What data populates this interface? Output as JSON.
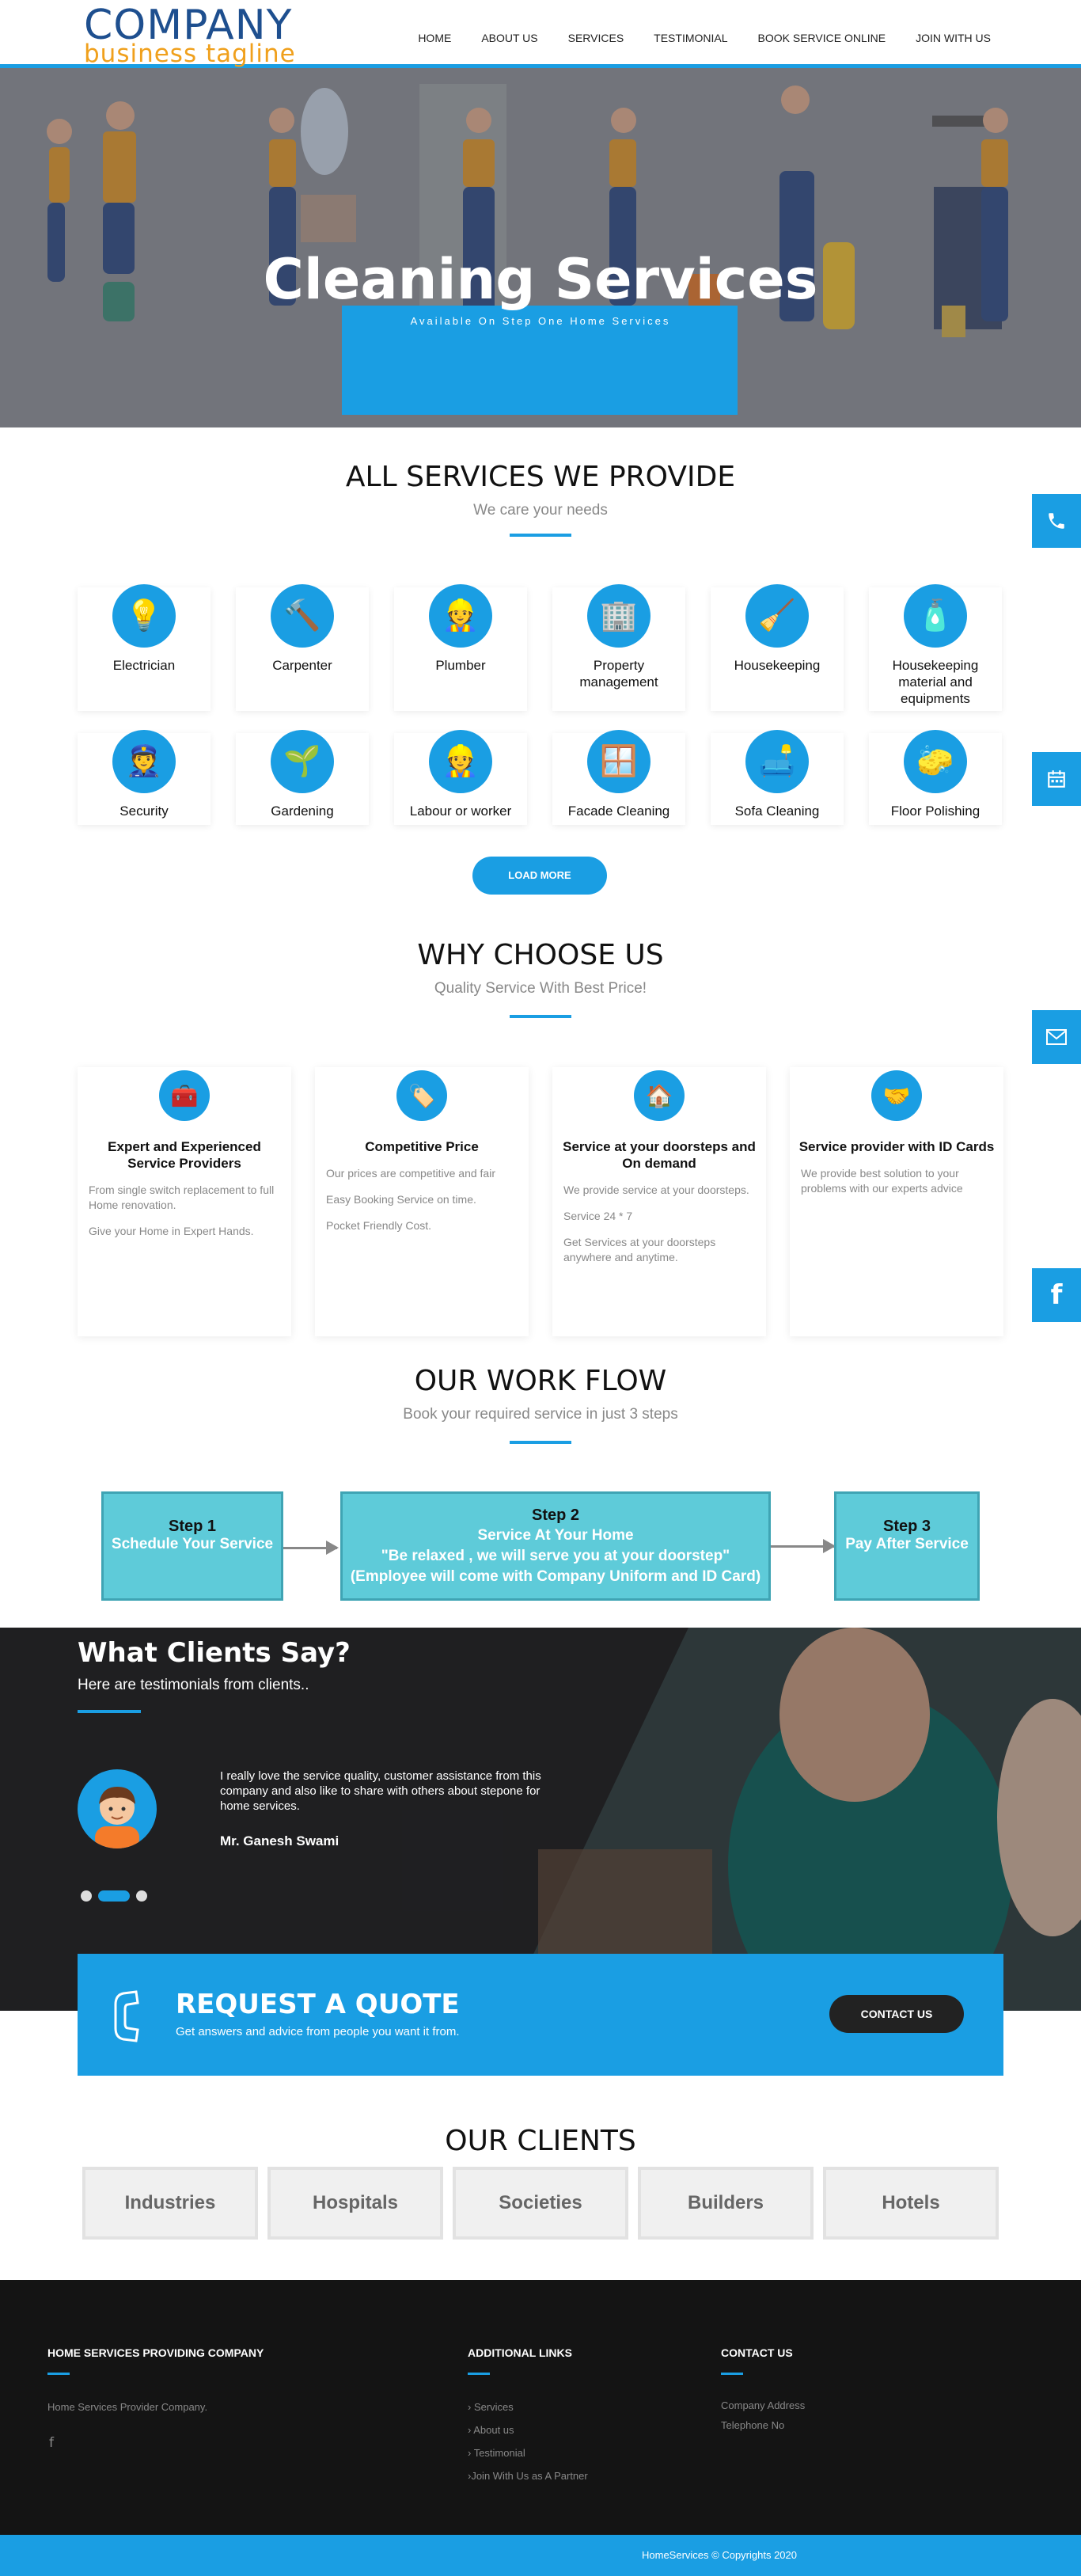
{
  "header": {
    "logo_main": "COMPANY",
    "logo_tagline": "business tagline",
    "nav": [
      "HOME",
      "ABOUT US",
      "SERVICES",
      "TESTIMONIAL",
      "BOOK SERVICE ONLINE",
      "JOIN WITH US"
    ]
  },
  "hero": {
    "title": "Cleaning Services",
    "subtitle": "Available On Step One Home Services"
  },
  "services": {
    "title": "ALL SERVICES WE PROVIDE",
    "subtitle": "We care your needs",
    "items": [
      {
        "label": "Electrician",
        "icon": "bulb-icon"
      },
      {
        "label": "Carpenter",
        "icon": "hammer-icon"
      },
      {
        "label": "Plumber",
        "icon": "plumber-icon"
      },
      {
        "label": "Property management",
        "icon": "property-icon"
      },
      {
        "label": "Housekeeping",
        "icon": "broom-icon"
      },
      {
        "label": "Housekeeping material and equipments",
        "icon": "supplies-icon"
      },
      {
        "label": "Security",
        "icon": "guard-icon"
      },
      {
        "label": "Gardening",
        "icon": "plant-icon"
      },
      {
        "label": "Labour or worker",
        "icon": "worker-icon"
      },
      {
        "label": "Facade Cleaning",
        "icon": "window-cleaning-icon"
      },
      {
        "label": "Sofa Cleaning",
        "icon": "sofa-icon"
      },
      {
        "label": "Floor Polishing",
        "icon": "mop-icon"
      }
    ],
    "load_more": "LOAD MORE"
  },
  "why": {
    "title": "WHY CHOOSE US",
    "subtitle": "Quality Service With Best Price!",
    "cards": [
      {
        "title": "Expert and Experienced Service Providers",
        "icon": "expert-icon",
        "lines": [
          "From single switch replacement to full Home renovation.",
          "Give your Home in Expert Hands."
        ]
      },
      {
        "title": "Competitive Price",
        "icon": "price-tag-icon",
        "lines": [
          "Our prices are competitive and fair",
          "Easy Booking Service on time.",
          "Pocket Friendly Cost."
        ]
      },
      {
        "title": "Service at your doorsteps and On demand",
        "icon": "home-icon",
        "lines": [
          "We provide service at your doorsteps.",
          "Service 24 * 7",
          "Get Services at your doorsteps anywhere and anytime."
        ]
      },
      {
        "title": "Service provider with ID Cards",
        "icon": "id-card-icon",
        "lines": [
          "We provide best solution to your problems with our experts advice"
        ]
      }
    ]
  },
  "workflow": {
    "title": "OUR WORK FLOW",
    "subtitle": "Book your required service in just 3 steps",
    "steps": [
      {
        "num": "Step 1",
        "text": "Schedule Your Service"
      },
      {
        "num": "Step 2",
        "line1": "Service At Your Home",
        "line2": "\"Be relaxed , we will serve you at your doorstep\"",
        "line3": "(Employee will come with Company Uniform and ID Card)"
      },
      {
        "num": "Step 3",
        "text": "Pay After Service"
      }
    ]
  },
  "testimonials": {
    "title": "What Clients Say?",
    "subtitle": "Here are testimonials from clients..",
    "quote": "I really love the service quality, customer assistance from this company and also like to share with others about stepone for home services.",
    "author": "Mr. Ganesh Swami"
  },
  "quote_cta": {
    "title": "REQUEST A QUOTE",
    "subtitle": "Get answers and advice from people you want it from.",
    "button": "CONTACT US"
  },
  "clients": {
    "title": "OUR CLIENTS",
    "items": [
      "Industries",
      "Hospitals",
      "Societies",
      "Builders",
      "Hotels"
    ]
  },
  "footer": {
    "col1_title": "HOME SERVICES PROVIDING COMPANY",
    "col1_text": "Home Services Provider Company.",
    "col2_title": "ADDITIONAL LINKS",
    "links": [
      "› Services",
      "› About us",
      "› Testimonial",
      "›Join With Us as A Partner"
    ],
    "col3_title": "CONTACT US",
    "address": "Company Address",
    "phone": "Telephone No",
    "copyright": "HomeServices © Copyrights 2020"
  },
  "colors": {
    "accent": "#1a9ee3",
    "step": "#5ecbd9",
    "footer": "#141414"
  }
}
